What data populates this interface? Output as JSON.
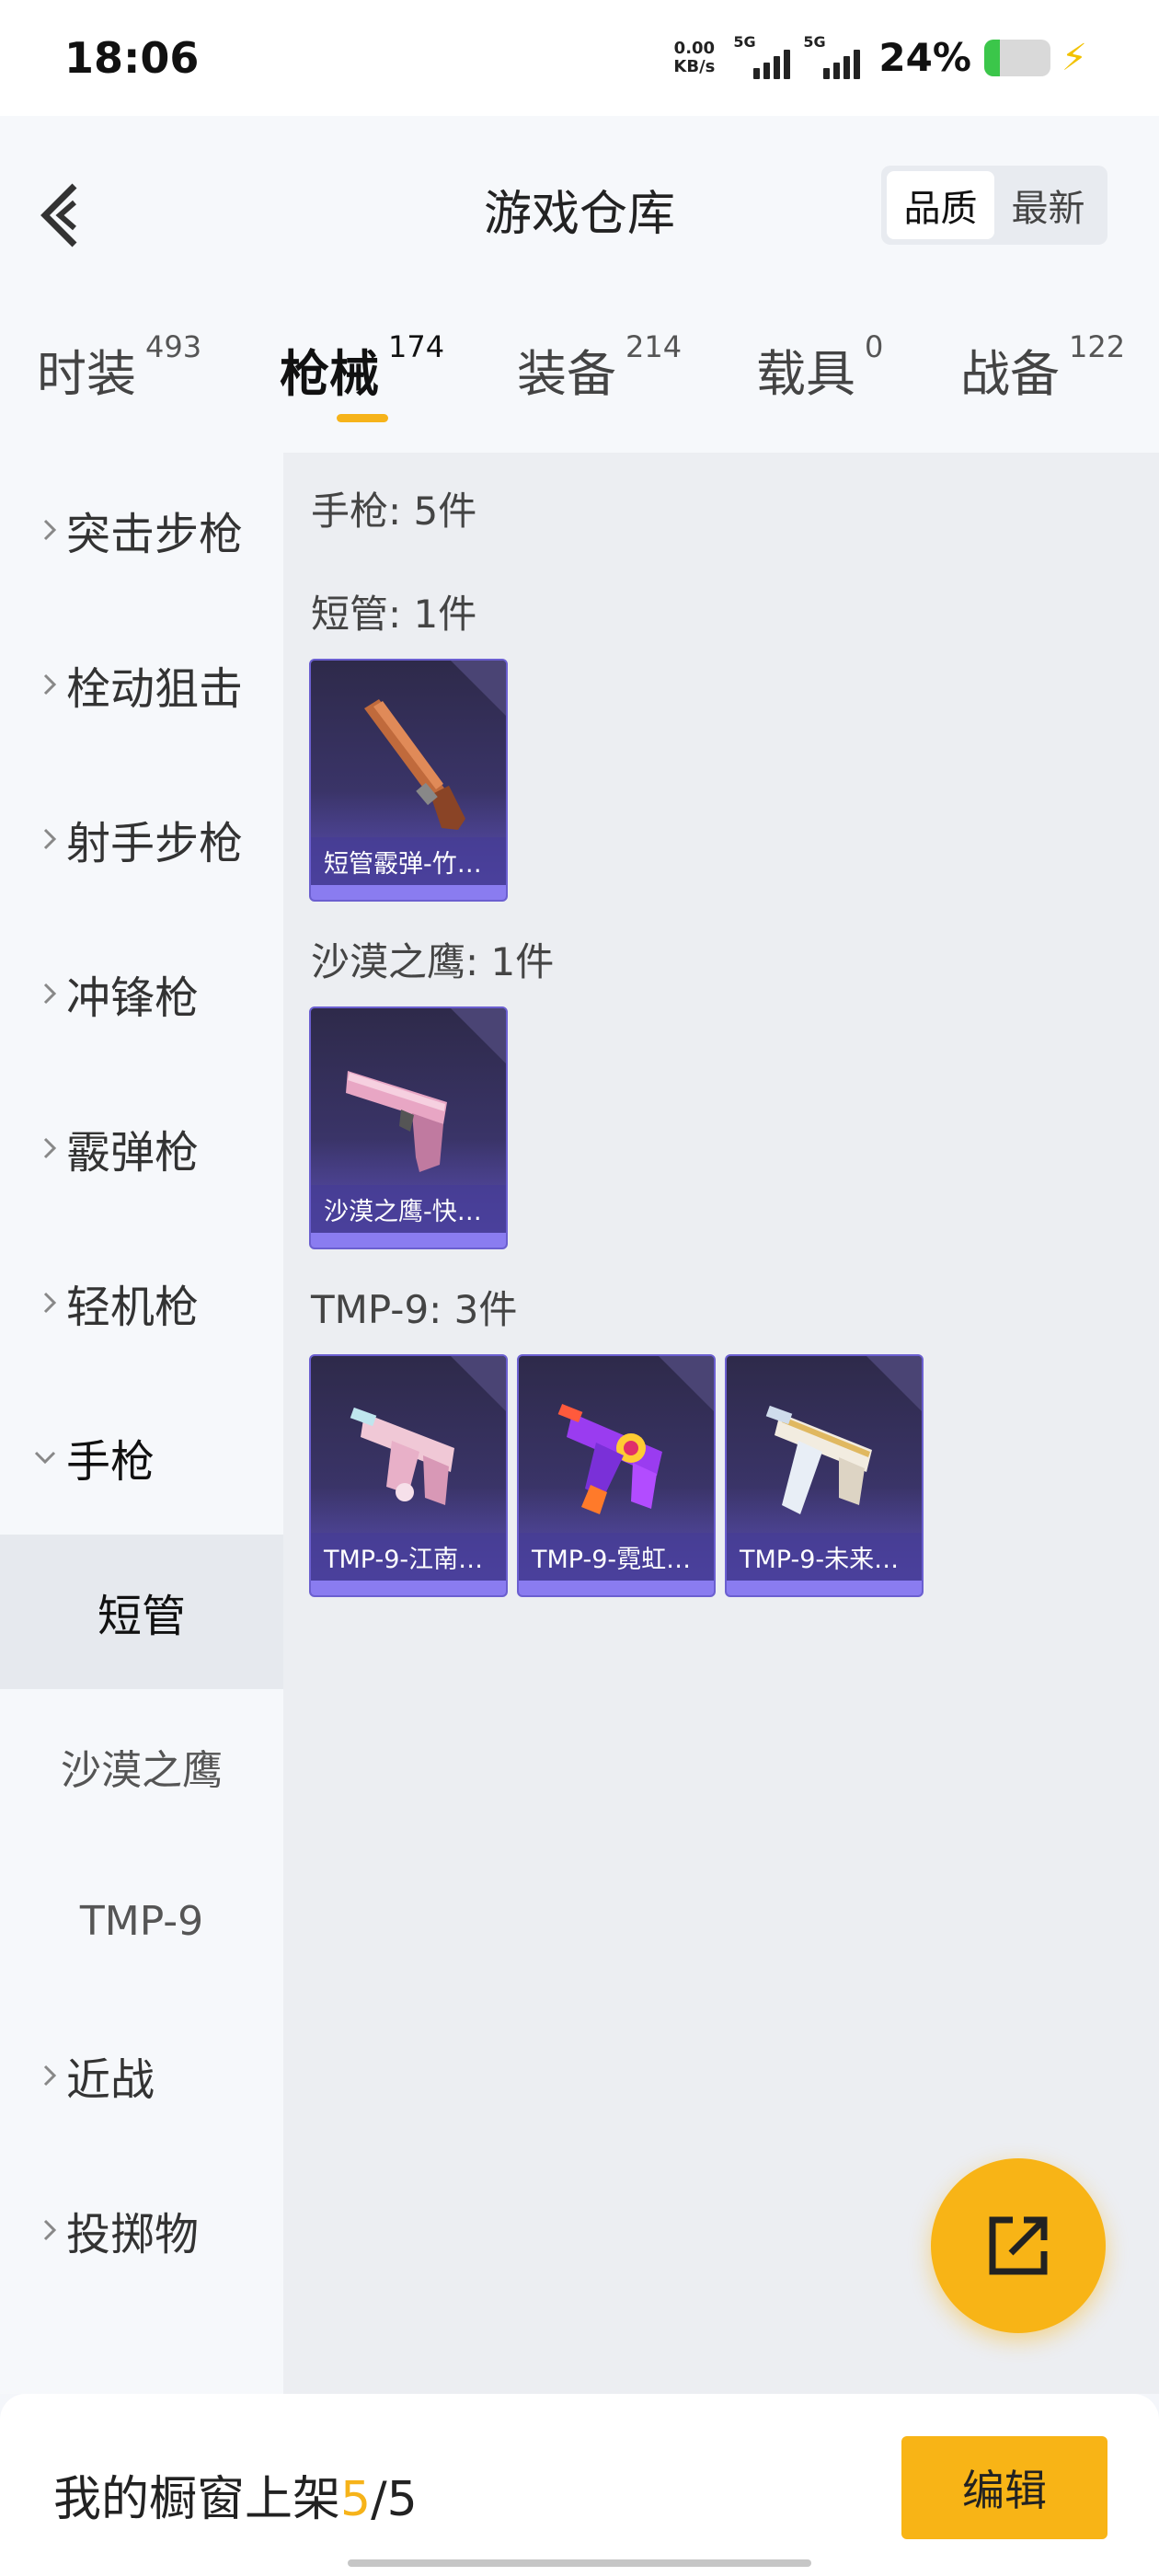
{
  "status_bar": {
    "time": "18:06",
    "net_speed_value": "0.00",
    "net_speed_unit": "KB/s",
    "signal1_label": "5G",
    "signal2_label": "5G",
    "battery_percent": "24%",
    "battery_level": 0.24,
    "battery_color": "#3bc64a",
    "charging_icon": "lightning-bolt-icon"
  },
  "header": {
    "title": "游戏仓库",
    "back_icon": "chevron-left-icon",
    "sort_options": [
      "品质",
      "最新"
    ],
    "sort_selected": "品质"
  },
  "tabs": [
    {
      "label": "时装",
      "count": "493"
    },
    {
      "label": "枪械",
      "count": "174",
      "active": true
    },
    {
      "label": "装备",
      "count": "214"
    },
    {
      "label": "载具",
      "count": "0"
    },
    {
      "label": "战备",
      "count": "122"
    }
  ],
  "sidebar": {
    "items": [
      {
        "label": "突击步枪"
      },
      {
        "label": "栓动狙击"
      },
      {
        "label": "射手步枪"
      },
      {
        "label": "冲锋枪"
      },
      {
        "label": "霰弹枪"
      },
      {
        "label": "轻机枪"
      },
      {
        "label": "手枪",
        "expanded": true
      },
      {
        "label": "近战"
      },
      {
        "label": "投掷物"
      }
    ],
    "sub_items": [
      {
        "label": "短管",
        "active": true
      },
      {
        "label": "沙漠之鹰"
      },
      {
        "label": "TMP-9"
      }
    ]
  },
  "content": {
    "summary": "手枪: 5件",
    "groups": [
      {
        "title": "短管: 1件",
        "items": [
          {
            "name": "短管霰弹-竹…",
            "icon": "sawed-off-shotgun-icon"
          }
        ]
      },
      {
        "title": "沙漠之鹰: 1件",
        "items": [
          {
            "name": "沙漠之鹰-快…",
            "icon": "desert-eagle-pistol-icon"
          }
        ]
      },
      {
        "title": "TMP-9: 3件",
        "items": [
          {
            "name": "TMP-9-江南…",
            "icon": "tmp9-pink-icon"
          },
          {
            "name": "TMP-9-霓虹…",
            "icon": "tmp9-neon-icon"
          },
          {
            "name": "TMP-9-未来…",
            "icon": "tmp9-white-icon"
          }
        ]
      }
    ],
    "card_accent": "#6b5fd0"
  },
  "fab": {
    "icon": "share-external-icon",
    "color": "#f8b416"
  },
  "bottom_bar": {
    "shelf_label": "我的橱窗上架",
    "shelf_count": "5",
    "shelf_total": "/5",
    "edit_label": "编辑",
    "accent": "#f6b31a"
  }
}
